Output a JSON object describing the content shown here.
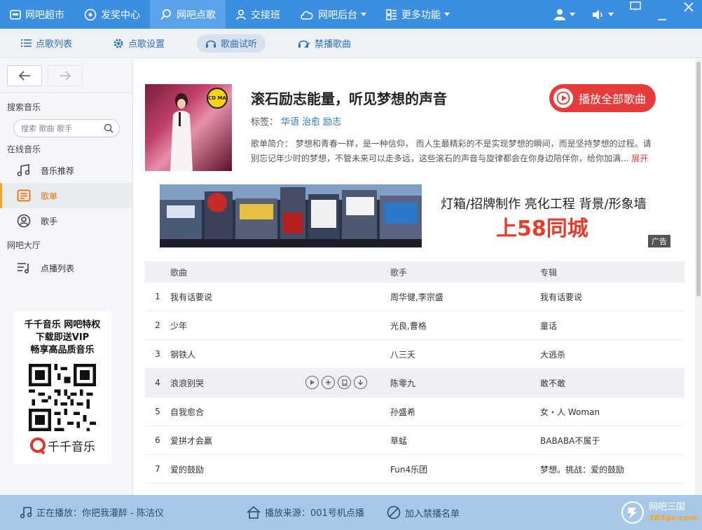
{
  "topnav": {
    "items": [
      {
        "label": "网吧超市",
        "icon": "store-icon"
      },
      {
        "label": "发奖中心",
        "icon": "gift-icon"
      },
      {
        "label": "网吧点歌",
        "icon": "search-icon",
        "active": true
      },
      {
        "label": "交接班",
        "icon": "user-icon"
      },
      {
        "label": "网吧后台",
        "icon": "cloud-icon"
      },
      {
        "label": "更多功能",
        "icon": "grid-icon"
      }
    ]
  },
  "subnav": {
    "items": [
      {
        "label": "点歌列表"
      },
      {
        "label": "点歌设置"
      },
      {
        "label": "歌曲试听",
        "active": true
      },
      {
        "label": "禁播歌曲"
      }
    ]
  },
  "sidebar": {
    "search_section": "搜索音乐",
    "search_placeholder": "搜索 歌曲 歌手",
    "online_section": "在线音乐",
    "online_items": [
      {
        "label": "音乐推荐"
      },
      {
        "label": "歌单",
        "active": true
      },
      {
        "label": "歌手"
      }
    ],
    "hall_section": "网吧大厅",
    "hall_items": [
      {
        "label": "点播列表"
      }
    ],
    "promo": {
      "line1": "千千音乐 网吧特权",
      "line2": "下载即送VIP",
      "line3": "畅享高品质音乐",
      "brand": "千千音乐"
    }
  },
  "playlist": {
    "cover_logo": "CD MA",
    "title": "滚石励志能量，听见梦想的声音",
    "tags_label": "标签：",
    "tags": [
      "华语",
      "治愈",
      "励志"
    ],
    "intro": "歌单简介： 梦想和青春一样，是一种信仰， 而人生最精彩的不是实现梦想的瞬间，而是坚持梦想的过程。请别忘记年少时的梦想，不管未来可以走多远，这些滚石的声音与旋律都会在你身边陪伴你，给你加满...",
    "expand": "展开",
    "play_all": "播放全部歌曲"
  },
  "ad": {
    "text1": "灯箱/招牌制作  亮化工程  背景/形象墙",
    "text2": "上58同城",
    "badge": "广告"
  },
  "table": {
    "headers": {
      "song": "歌曲",
      "artist": "歌手",
      "album": "专辑"
    },
    "rows": [
      {
        "num": "1",
        "song": "我有话要说",
        "artist": "周华健,李宗盛",
        "album": "我有话要说"
      },
      {
        "num": "2",
        "song": "少年",
        "artist": "光良,曹格",
        "album": "童话"
      },
      {
        "num": "3",
        "song": "钢铁人",
        "artist": "八三夭",
        "album": "大逃杀"
      },
      {
        "num": "4",
        "song": "浪浪别哭",
        "artist": "陈零九",
        "album": "敢不敢"
      },
      {
        "num": "5",
        "song": "自我愈合",
        "artist": "孙盛希",
        "album": "女・人 Woman"
      },
      {
        "num": "6",
        "song": "爱拼才会赢",
        "artist": "草蜢",
        "album": "BABABA不属于"
      },
      {
        "num": "7",
        "song": "爱的鼓励",
        "artist": "Fun4乐团",
        "album": "梦想。挑战：爱的鼓励"
      }
    ]
  },
  "bottombar": {
    "now_label": "正在播放：",
    "now_song": "你把我灌醉 - 陈洁仪",
    "source": "播放来源：001号机点播",
    "ban": "加入禁播名单",
    "logo_line1": "网吧三国",
    "logo_line2": "5B3go.com"
  },
  "colors": {
    "topnav": "#3c8fe0",
    "accent_red": "#e53b3b",
    "link_blue": "#2d7cc4",
    "active_orange": "#f5a623",
    "bottombar": "#a8c8ea"
  }
}
